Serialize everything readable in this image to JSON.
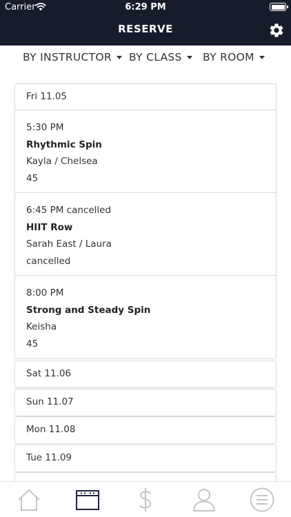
{
  "status_bar": {
    "carrier": "Carrier",
    "time": "6:29 PM"
  },
  "header": {
    "title": "RESERVE"
  },
  "filters": [
    {
      "label": "BY INSTRUCTOR"
    },
    {
      "label": "BY CLASS"
    },
    {
      "label": "BY ROOM"
    }
  ],
  "schedule": {
    "open_day": {
      "date": "Fri 11.05",
      "sessions": [
        {
          "time": "5:30 PM",
          "name": "Rhythmic Spin",
          "instructor": "Kayla / Chelsea",
          "info": "45"
        },
        {
          "time": "6:45 PM cancelled",
          "name": "HIIT Row",
          "instructor": "Sarah East / Laura",
          "info": "cancelled"
        },
        {
          "time": "8:00 PM",
          "name": "Strong and Steady Spin",
          "instructor": "Keisha",
          "info": "45"
        }
      ]
    },
    "other_days": [
      "Sat 11.06",
      "Sun 11.07",
      "Mon 11.08",
      "Tue 11.09"
    ]
  },
  "tabbar": {
    "tabs": [
      {
        "icon": "home-icon",
        "active": false
      },
      {
        "icon": "calendar-icon",
        "active": true
      },
      {
        "icon": "dollar-icon",
        "active": false
      },
      {
        "icon": "user-icon",
        "active": false
      },
      {
        "icon": "menu-icon",
        "active": false
      }
    ]
  },
  "colors": {
    "header_bg": "#171c2b",
    "active_tab": "#1d2436",
    "inactive_tab": "#c4c4c4",
    "border": "#d9d9d9"
  }
}
